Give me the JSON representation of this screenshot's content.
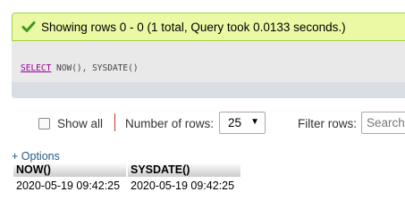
{
  "status": {
    "message": "Showing rows 0 - 0 (1 total, Query took 0.0133 seconds.)",
    "color_success": "#ebf8a4",
    "icon": "check-icon"
  },
  "sql": {
    "keyword": "SELECT",
    "rest": " NOW(), SYSDATE()"
  },
  "navigation": {
    "show_all_label": "Show all",
    "number_of_rows_label": "Number of rows:",
    "rows_value": "25",
    "filter_rows_label": "Filter rows:",
    "filter_placeholder": "Search this table"
  },
  "options_link": "+ Options",
  "table": {
    "columns": [
      "NOW()",
      "SYSDATE()"
    ],
    "rows": [
      [
        "2020-05-19 09:42:25",
        "2020-05-19 09:42:25"
      ]
    ]
  }
}
